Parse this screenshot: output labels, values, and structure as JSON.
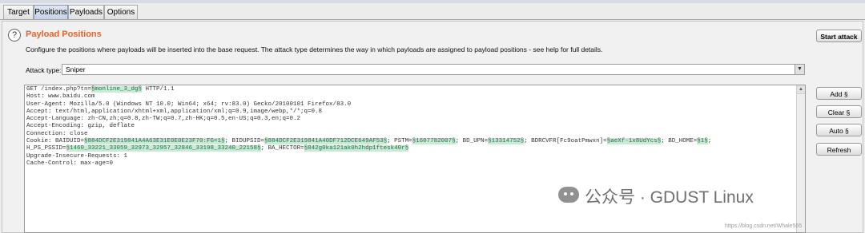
{
  "tabs": [
    {
      "label": "Target",
      "active": false
    },
    {
      "label": "Positions",
      "active": true
    },
    {
      "label": "Payloads",
      "active": false
    },
    {
      "label": "Options",
      "active": false
    }
  ],
  "help_icon": {
    "glyph": "?",
    "icon": "help-circle-icon"
  },
  "section": {
    "title": "Payload Positions",
    "description": "Configure the positions where payloads will be inserted into the base request. The attack type determines the way in which payloads are assigned to payload positions - see help for full details."
  },
  "start_attack_label": "Start attack",
  "attack_type": {
    "label": "Attack type:",
    "value": "Sniper",
    "arrow": "▼"
  },
  "request": {
    "lines": [
      [
        {
          "t": "GET /index.php?tn="
        },
        {
          "t": "§monline_3_dg§",
          "m": true
        },
        {
          "t": " HTTP/1.1"
        }
      ],
      [
        {
          "t": "Host: www.baidu.com"
        }
      ],
      [
        {
          "t": "User-Agent: Mozilla/5.0 (Windows NT 10.0; Win64; x64; rv:83.0) Gecko/20100101 Firefox/83.0"
        }
      ],
      [
        {
          "t": "Accept: text/html,application/xhtml+xml,application/xml;q=0.9,image/webp,*/*;q=0.8"
        }
      ],
      [
        {
          "t": "Accept-Language: zh-CN,zh;q=0.8,zh-TW;q=0.7,zh-HK;q=0.5,en-US;q=0.3,en;q=0.2"
        }
      ],
      [
        {
          "t": "Accept-Encoding: gzip, deflate"
        }
      ],
      [
        {
          "t": "Connection: close"
        }
      ],
      [
        {
          "t": "Cookie: BAIDUID="
        },
        {
          "t": "§884DCF2E319841A4A63E31E0E0E23F70:FG=1§",
          "m": true
        },
        {
          "t": "; BIDUPSID="
        },
        {
          "t": "§884DCF2E319841A40DF712DCE649AF53§",
          "m": true
        },
        {
          "t": "; PSTM="
        },
        {
          "t": "§1607782007§",
          "m": true
        },
        {
          "t": "; BD_UPN="
        },
        {
          "t": "§13314752§",
          "m": true
        },
        {
          "t": "; BDRCVFR[Fc9oatPmwxn]="
        },
        {
          "t": "§aeXf-1x8UdYcs§",
          "m": true
        },
        {
          "t": "; BD_HOME="
        },
        {
          "t": "§1§",
          "m": true
        },
        {
          "t": ";"
        }
      ],
      [
        {
          "t": "H_PS_PSSID="
        },
        {
          "t": "§1460_33221_33059_32973_32957_32846_33198_33240_22158§",
          "m": true
        },
        {
          "t": "; BA_HECTOR="
        },
        {
          "t": "§842g0ka121ak0h2hdp1ftesk40r§",
          "m": true
        }
      ],
      [
        {
          "t": "Upgrade-Insecure-Requests: 1"
        }
      ],
      [
        {
          "t": "Cache-Control: max-age=0"
        }
      ]
    ]
  },
  "side_buttons": {
    "add": "Add §",
    "clear": "Clear §",
    "auto": "Auto §",
    "refresh": "Refresh"
  },
  "scroll_up_glyph": "▲",
  "watermark": {
    "text": "公众号 · GDUST Linux",
    "url": "https://blog.csdn.net/Whale565"
  },
  "colors": {
    "title": "#e2652f",
    "marker_bg": "#cce8d6",
    "marker_fg": "#1e6f45",
    "active_tab": "#c5d2e6"
  }
}
